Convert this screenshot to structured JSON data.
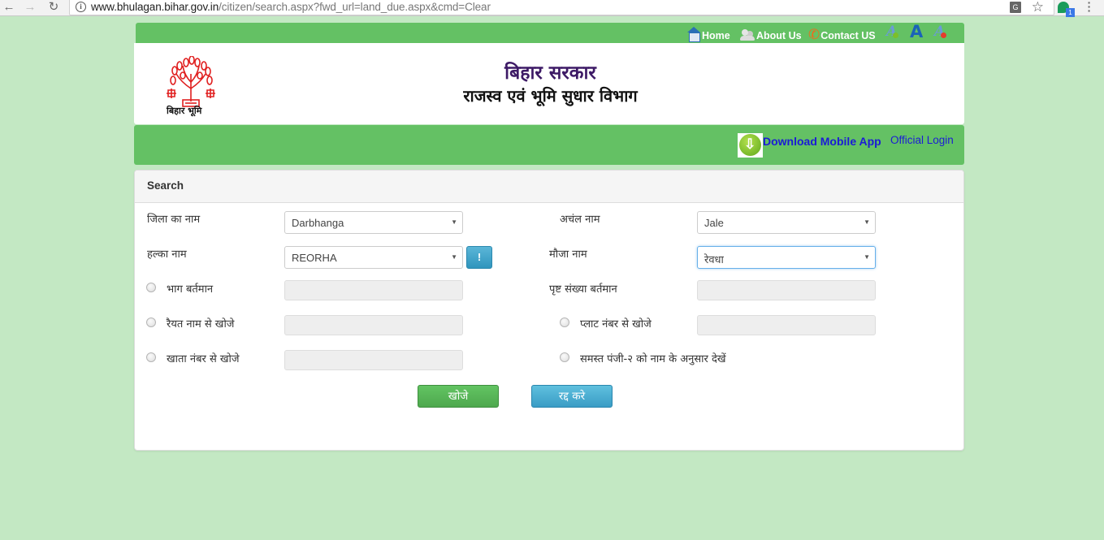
{
  "browser": {
    "url_host": "www.bhulagan.bihar.gov.in",
    "url_path": "/citizen/search.aspx?fwd_url=land_due.aspx&cmd=Clear",
    "extension_badge": "1",
    "icons": {
      "back": "arrow-left-icon",
      "forward": "arrow-right-icon",
      "reload": "reload-icon",
      "info": "info-icon",
      "translate": "translate-icon",
      "bookmark": "star-icon",
      "extension": "extension-icon",
      "menu": "kebab-menu-icon"
    }
  },
  "topnav": {
    "home": "Home",
    "about": "About Us",
    "contact": "Contact US",
    "font_increase": "A",
    "font_normal": "A",
    "font_decrease": "A"
  },
  "header": {
    "logo_caption": "बिहार भूमि",
    "gov_title": "बिहार सरकार",
    "dept_title": "राजस्व एवं भूमि सुधार विभाग"
  },
  "appbar": {
    "download_app": "Download Mobile App",
    "official_login": "Official Login"
  },
  "search": {
    "title": "Search",
    "fields": {
      "district": {
        "label": "जिला का नाम",
        "value": "Darbhanga"
      },
      "circle": {
        "label": "अचंल नाम",
        "value": "Jale"
      },
      "halka": {
        "label": "हल्का नाम",
        "value": "REORHA",
        "info_button": "!"
      },
      "mauza": {
        "label": "मौजा नाम",
        "value": "रेवधा"
      },
      "bhag": {
        "label": "भाग बर्तमान",
        "value": ""
      },
      "page_no": {
        "label": "पृष्ट संख्या बर्तमान",
        "value": ""
      },
      "raiyat": {
        "label": "रैयत नाम से खोजे",
        "value": ""
      },
      "plot": {
        "label": "प्लाट नंबर से खोजे",
        "value": ""
      },
      "khata": {
        "label": "खाता नंबर से खोजे",
        "value": ""
      },
      "all_register": {
        "label": "समस्त पंजी-२ को नाम के अनुसार देखें"
      }
    },
    "buttons": {
      "search": "खोजे",
      "cancel": "रद्द करे"
    },
    "colors": {
      "search_button": "#5cb85c",
      "cancel_button": "#46a8d0"
    }
  },
  "theme": {
    "page_bg": "#c3e8c3",
    "bar_green": "#64c164",
    "link_blue": "#1b1bd6",
    "title_purple": "#3d1a66"
  }
}
